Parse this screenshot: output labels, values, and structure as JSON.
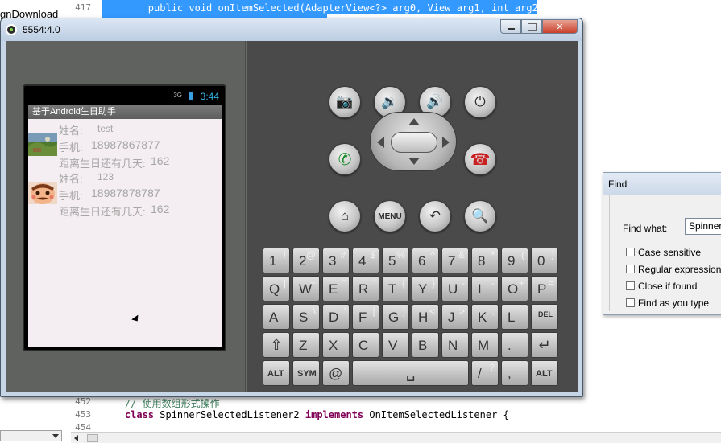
{
  "ide": {
    "tree_item": "gnDownload",
    "line_numbers": {
      "top": "417",
      "b452": "452",
      "b453": "453",
      "b454": "454"
    },
    "code_top": "        public void onItemSelected(AdapterView<?> arg0, View arg1, int arg2,",
    "code_452_comment": "// 使用数组形式操作",
    "code_453_kw": "class",
    "code_453_a": " SpinnerSelectedListener2 ",
    "code_453_kw2": "implements",
    "code_453_b": " OnItemSelectedListener {"
  },
  "emulator": {
    "title": "5554:4.0",
    "status_signal": "3G",
    "status_time": "3:44",
    "app_title": "基于Android生日助手",
    "contacts": [
      {
        "name_label": "姓名:",
        "name_value": "test",
        "phone_label": "手机:",
        "phone_value": "18987867877",
        "days_label": "距离生日还有几天:",
        "days_value": "162",
        "avatar": "landscape-photo"
      },
      {
        "name_label": "姓名:",
        "name_value": "123",
        "phone_label": "手机:",
        "phone_value": "18987878787",
        "days_label": "距离生日还有几天:",
        "days_value": "162",
        "avatar": "cartoon-face"
      }
    ],
    "buttons": {
      "camera": "camera-icon",
      "vol_down": "volume-down-icon",
      "vol_up": "volume-up-icon",
      "power": "power-icon",
      "call": "call-icon",
      "end_call": "end-call-icon",
      "home": "home-icon",
      "menu": "MENU",
      "back": "back-icon",
      "search": "search-icon"
    },
    "keyboard": {
      "row1": [
        [
          "1",
          "!"
        ],
        [
          "2",
          "@"
        ],
        [
          "3",
          "#"
        ],
        [
          "4",
          "$"
        ],
        [
          "5",
          "%"
        ],
        [
          "6",
          "^"
        ],
        [
          "7",
          "&"
        ],
        [
          "8",
          "*"
        ],
        [
          "9",
          "("
        ],
        [
          "0",
          ")"
        ]
      ],
      "row2": [
        [
          "Q",
          "|"
        ],
        [
          "W",
          "~"
        ],
        [
          "E",
          "\""
        ],
        [
          "R",
          "`"
        ],
        [
          "T",
          "{"
        ],
        [
          "Y",
          "}"
        ],
        [
          "U",
          "-"
        ],
        [
          "I",
          "-"
        ],
        [
          "O",
          "+"
        ],
        [
          "P",
          "="
        ]
      ],
      "row3": [
        [
          "A",
          ""
        ],
        [
          "S",
          "\\"
        ],
        [
          "D",
          "'"
        ],
        [
          "F",
          "["
        ],
        [
          "G",
          "]"
        ],
        [
          "H",
          "<"
        ],
        [
          "J",
          ">"
        ],
        [
          "K",
          ";"
        ],
        [
          "L",
          ":"
        ],
        [
          "DEL",
          ""
        ]
      ],
      "row4": [
        [
          "⇧",
          ""
        ],
        [
          "Z",
          ""
        ],
        [
          "X",
          ""
        ],
        [
          "C",
          ""
        ],
        [
          "V",
          ""
        ],
        [
          "B",
          ""
        ],
        [
          "N",
          ""
        ],
        [
          "M",
          ""
        ],
        [
          ".",
          ""
        ],
        [
          "↵",
          ""
        ]
      ],
      "row5_alt": "ALT",
      "row5_sym": "SYM",
      "row5_at": "@",
      "row5_slash": "/",
      "row5_slash_alt": "?",
      "row5_comma": ",",
      "row5_alt2": "ALT"
    }
  },
  "find": {
    "title": "Find",
    "find_what_label": "Find what:",
    "find_what_value": "SpinnerS",
    "options": [
      {
        "label": "Case sensitive",
        "checked": false
      },
      {
        "label": "Regular expression",
        "checked": false
      },
      {
        "label": "Close if found",
        "checked": false
      },
      {
        "label": "Find as you type",
        "checked": false
      }
    ]
  }
}
